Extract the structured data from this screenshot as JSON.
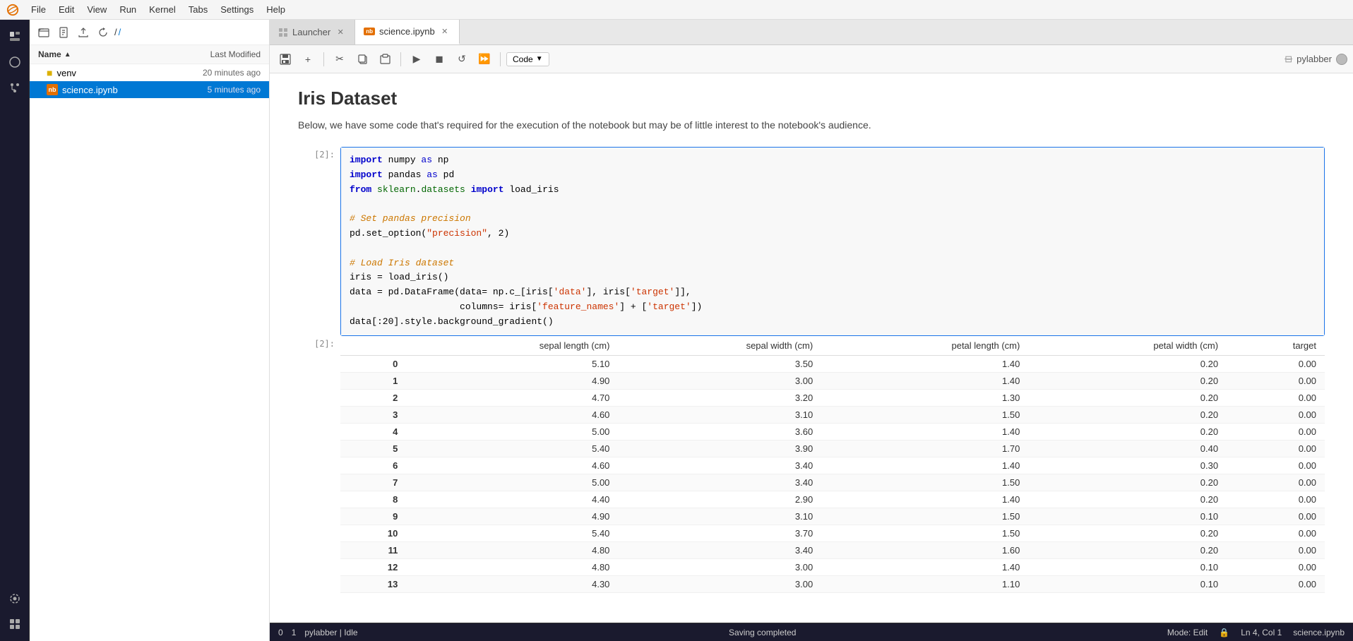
{
  "menu": {
    "logo": "🪐",
    "items": [
      "File",
      "Edit",
      "View",
      "Run",
      "Kernel",
      "Tabs",
      "Settings",
      "Help"
    ]
  },
  "icon_sidebar": {
    "icons": [
      {
        "name": "folder-icon",
        "symbol": "📁",
        "active": true
      },
      {
        "name": "circle-icon",
        "symbol": "○"
      },
      {
        "name": "tag-icon",
        "symbol": "🏷"
      },
      {
        "name": "gear-icon",
        "symbol": "⚙"
      },
      {
        "name": "plugin-icon",
        "symbol": "🧩"
      },
      {
        "name": "sidebar-bottom",
        "symbol": "🔲"
      }
    ]
  },
  "file_panel": {
    "path": "/ /",
    "header": {
      "name_label": "Name",
      "modified_label": "Last Modified"
    },
    "files": [
      {
        "name": "venv",
        "type": "folder",
        "modified": "20 minutes ago"
      },
      {
        "name": "science.ipynb",
        "type": "notebook",
        "modified": "5 minutes ago",
        "selected": true
      }
    ]
  },
  "tabs": [
    {
      "label": "Launcher",
      "active": false,
      "closable": true,
      "icon": "launcher"
    },
    {
      "label": "science.ipynb",
      "active": true,
      "closable": true,
      "icon": "notebook"
    }
  ],
  "toolbar": {
    "buttons": [
      "save",
      "add-cell",
      "cut",
      "copy",
      "paste",
      "run",
      "stop",
      "restart",
      "fast-forward"
    ],
    "cell_type": "Code"
  },
  "notebook": {
    "title": "Iris Dataset",
    "description": "Below, we have some code that's required for the execution of the notebook but may be of little interest to the notebook's audience.",
    "cell_label": "[2]:",
    "output_label": "[2]:",
    "code_lines": [
      "import numpy as np",
      "import pandas as pd",
      "from sklearn.datasets import load_iris",
      "",
      "# Set pandas precision",
      "pd.set_option(\"precision\", 2)",
      "",
      "# Load Iris dataset",
      "iris = load_iris()",
      "data = pd.DataFrame(data= np.c_[iris['data'], iris['target']],",
      "                    columns= iris['feature_names'] + ['target'])",
      "data[:20].style.background_gradient()"
    ],
    "table": {
      "headers": [
        "",
        "sepal length (cm)",
        "sepal width (cm)",
        "petal length (cm)",
        "petal width (cm)",
        "target"
      ],
      "rows": [
        [
          0,
          5.1,
          3.5,
          1.4,
          0.2,
          0.0
        ],
        [
          1,
          4.9,
          3.0,
          1.4,
          0.2,
          0.0
        ],
        [
          2,
          4.7,
          3.2,
          1.3,
          0.2,
          0.0
        ],
        [
          3,
          4.6,
          3.1,
          1.5,
          0.2,
          0.0
        ],
        [
          4,
          5.0,
          3.6,
          1.4,
          0.2,
          0.0
        ],
        [
          5,
          5.4,
          3.9,
          1.7,
          0.4,
          0.0
        ],
        [
          6,
          4.6,
          3.4,
          1.4,
          0.3,
          0.0
        ],
        [
          7,
          5.0,
          3.4,
          1.5,
          0.2,
          0.0
        ],
        [
          8,
          4.4,
          2.9,
          1.4,
          0.2,
          0.0
        ],
        [
          9,
          4.9,
          3.1,
          1.5,
          0.1,
          0.0
        ],
        [
          10,
          5.4,
          3.7,
          1.5,
          0.2,
          0.0
        ],
        [
          11,
          4.8,
          3.4,
          1.6,
          0.2,
          0.0
        ],
        [
          12,
          4.8,
          3.0,
          1.4,
          0.1,
          0.0
        ],
        [
          13,
          4.3,
          3.0,
          1.1,
          0.1,
          0.0
        ]
      ]
    }
  },
  "status_bar": {
    "left": [
      "0",
      "1",
      "pylabber | Idle"
    ],
    "center": "Saving completed",
    "right": [
      "Mode: Edit",
      "🔒",
      "Ln 4, Col 1",
      "science.ipynb"
    ]
  },
  "user": {
    "name": "pylabber"
  }
}
